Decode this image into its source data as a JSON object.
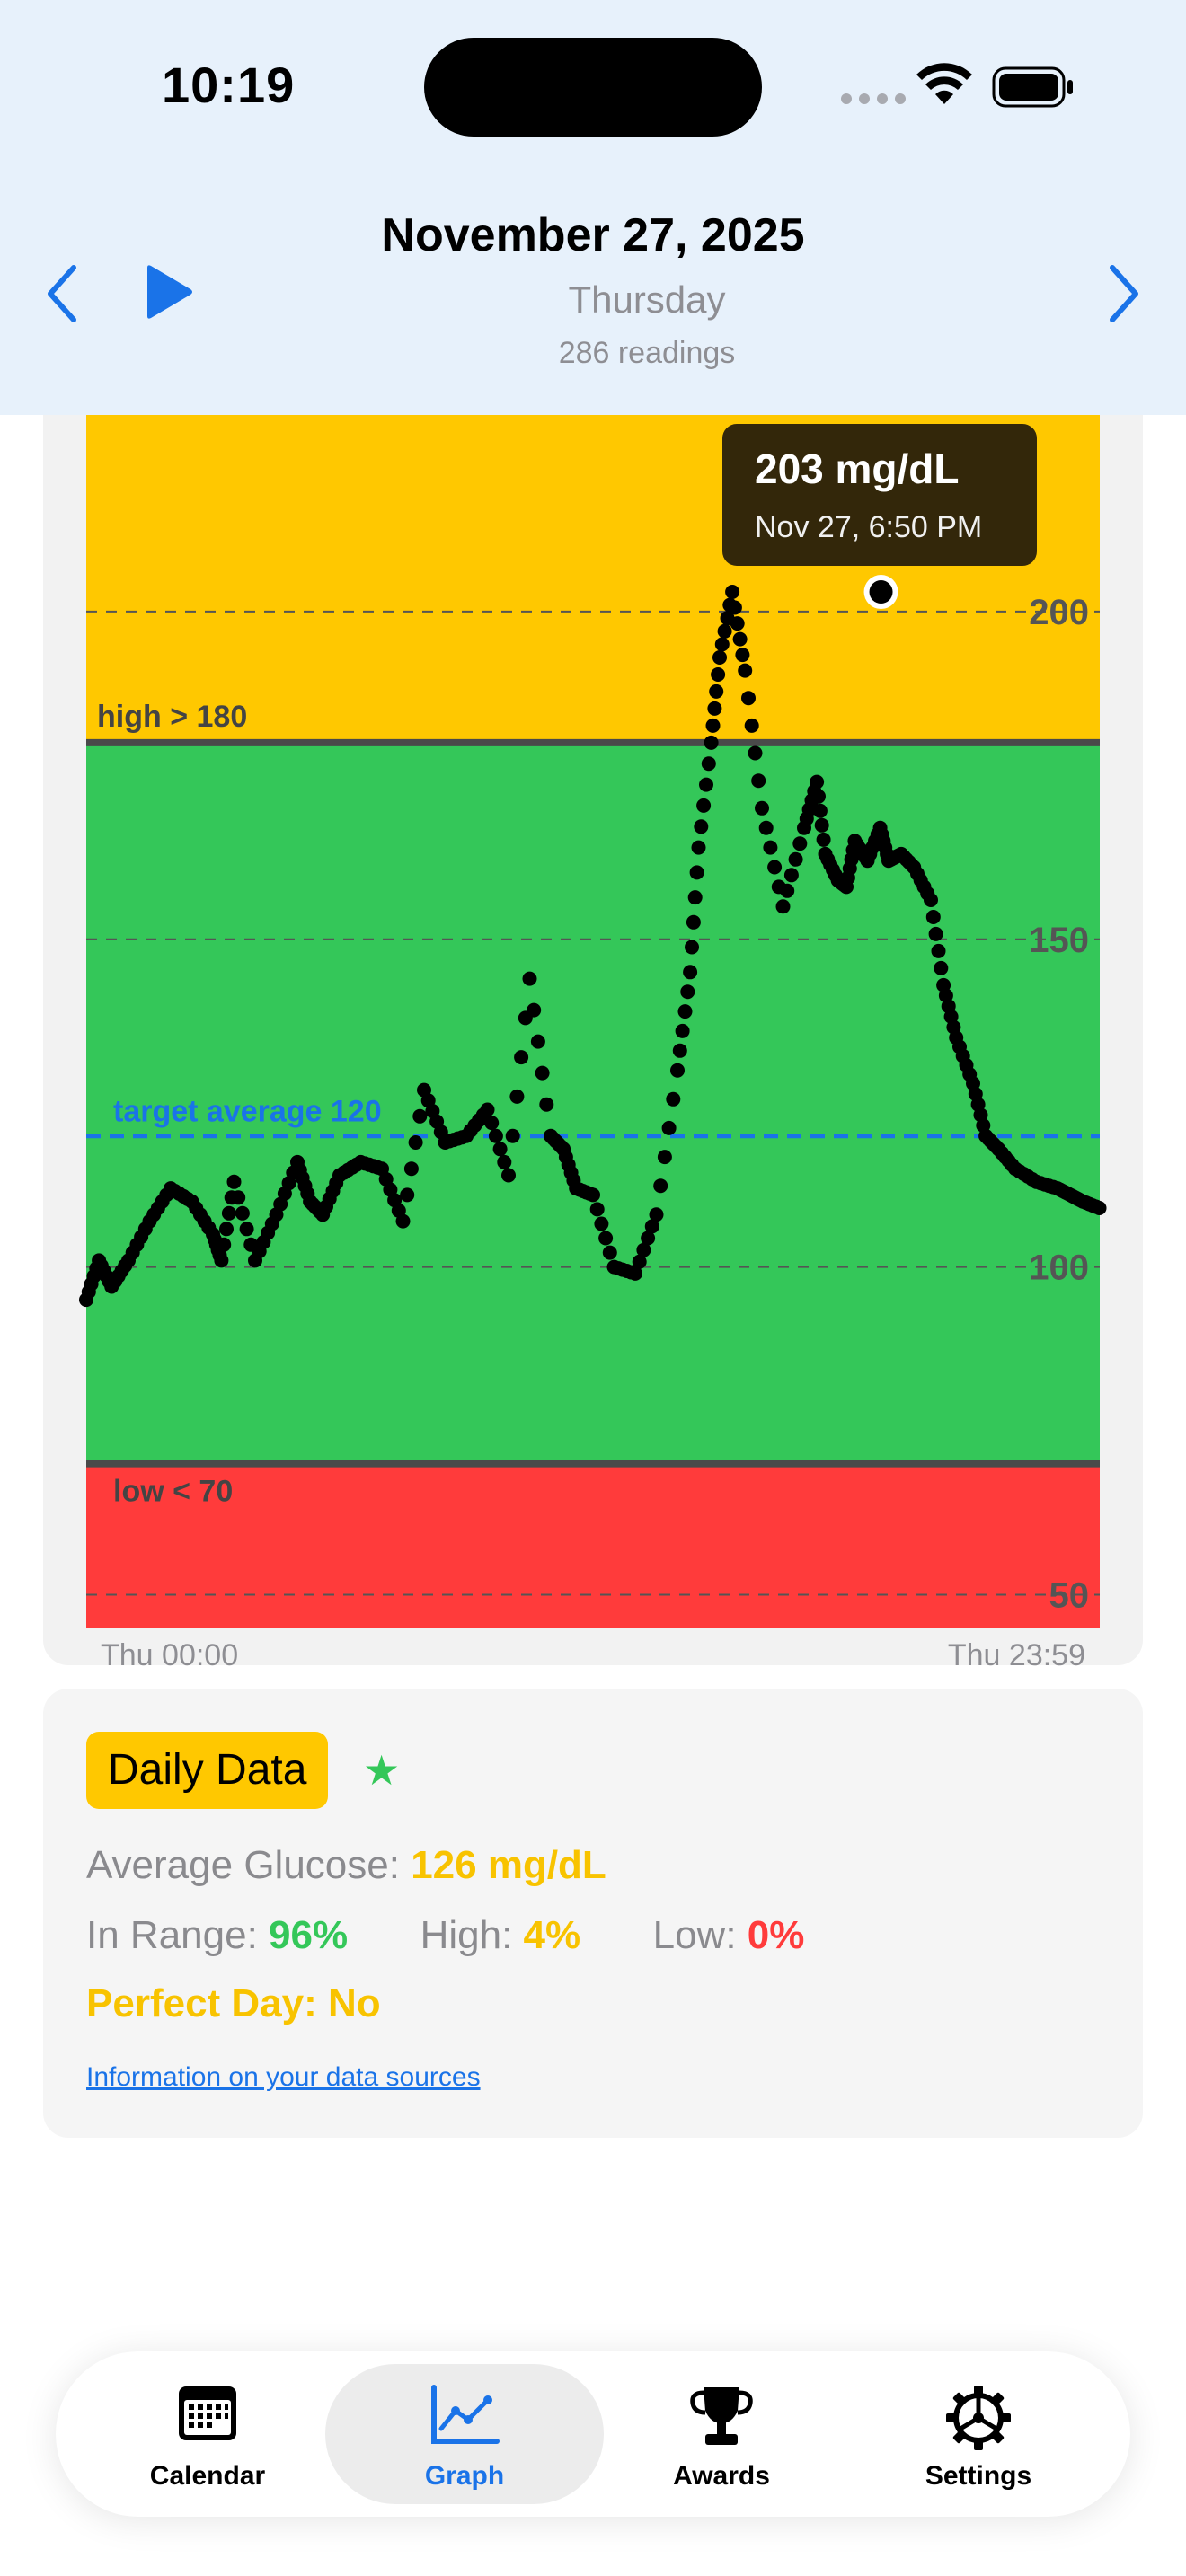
{
  "status_bar": {
    "time": "10:19"
  },
  "header": {
    "date": "November 27, 2025",
    "weekday": "Thursday",
    "readings": "286 readings"
  },
  "chart_data": {
    "type": "scatter",
    "y_unit": "mg/dL",
    "ylim": [
      45,
      230
    ],
    "y_ticks": [
      50,
      100,
      150,
      200
    ],
    "y_tick_labels": [
      "50",
      "100",
      "150",
      "200"
    ],
    "x_start_label": "Thu 00:00",
    "x_end_label": "Thu 23:59",
    "grid": true,
    "bands": [
      {
        "label": "high > 180",
        "from": 180,
        "to": 230,
        "color": "#ffc800"
      },
      {
        "label": "",
        "from": 70,
        "to": 180,
        "color": "#34c759"
      },
      {
        "label": "low < 70",
        "from": 45,
        "to": 70,
        "color": "#ff3b3b"
      }
    ],
    "target": {
      "label": "target average 120",
      "value": 120,
      "color": "#1a73e8"
    },
    "x_hours": [
      0,
      0.3,
      0.6,
      1.0,
      1.5,
      2.0,
      2.5,
      3.0,
      3.2,
      3.5,
      4.0,
      4.5,
      5.0,
      5.3,
      5.6,
      6.0,
      6.5,
      7.0,
      7.5,
      8.0,
      8.5,
      9.0,
      9.5,
      10.0,
      10.5,
      11.0,
      11.3,
      11.6,
      12.0,
      12.5,
      13.0,
      13.5,
      14.0,
      14.3,
      14.5,
      14.8,
      15.0,
      15.3,
      15.6,
      16.0,
      16.5,
      17.0,
      17.3,
      17.5,
      17.8,
      18.0,
      18.2,
      18.5,
      18.8,
      19.0,
      19.3,
      19.6,
      20.0,
      20.3,
      20.6,
      21.0,
      21.3,
      21.6,
      22.0,
      22.5,
      23.0,
      23.3,
      23.6,
      23.99
    ],
    "values": [
      95,
      101,
      97,
      101,
      107,
      112,
      110,
      105,
      101,
      113,
      101,
      108,
      116,
      110,
      108,
      114,
      116,
      115,
      107,
      127,
      119,
      120,
      124,
      114,
      144,
      120,
      118,
      112,
      111,
      100,
      99,
      108,
      130,
      145,
      164,
      180,
      193,
      203,
      191,
      170,
      155,
      167,
      174,
      163,
      159,
      158,
      165,
      162,
      167,
      162,
      163,
      161,
      156,
      143,
      135,
      128,
      120,
      118,
      115,
      113,
      112,
      111,
      110,
      109
    ],
    "tooltip": {
      "value": "203 mg/dL",
      "time": "Nov 27, 6:50 PM",
      "x_hour": 18.82,
      "y_value": 203
    }
  },
  "daily": {
    "title": "Daily Data",
    "star": "★",
    "avg_label": "Average Glucose:",
    "avg_value": "126 mg/dL",
    "in_range_label": "In Range:",
    "in_range_value": "96%",
    "high_label": "High:",
    "high_value": "4%",
    "low_label": "Low:",
    "low_value": "0%",
    "perfect_day": "Perfect Day: No",
    "info_link": "Information on your data sources"
  },
  "tabs": [
    {
      "label": "Calendar",
      "icon": "calendar-icon",
      "active": false
    },
    {
      "label": "Graph",
      "icon": "graph-icon",
      "active": true
    },
    {
      "label": "Awards",
      "icon": "trophy-icon",
      "active": false
    },
    {
      "label": "Settings",
      "icon": "gear-icon",
      "active": false
    }
  ],
  "colors": {
    "accent": "#1a73e8",
    "high": "#ffc800",
    "in_range": "#34c759",
    "low": "#ff3b3b"
  }
}
